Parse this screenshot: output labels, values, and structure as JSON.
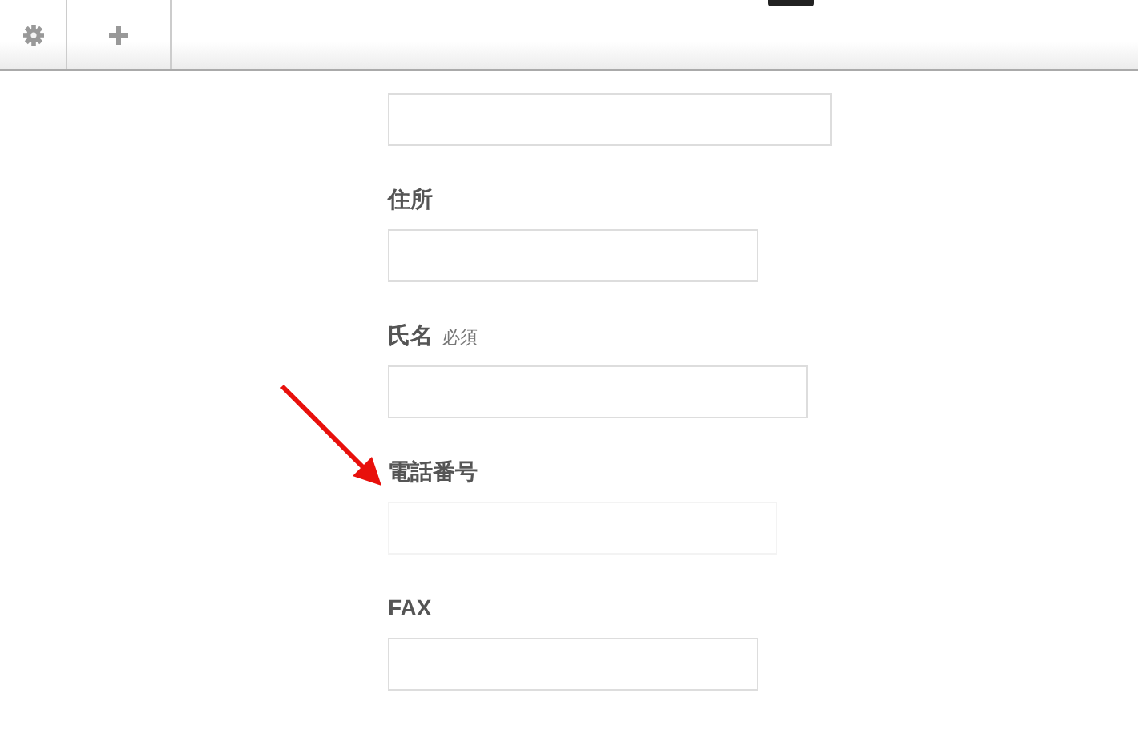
{
  "toolbar": {
    "buttons": [
      {
        "kind": "settings"
      },
      {
        "kind": "add"
      }
    ]
  },
  "top_field": {
    "kind": "normal"
  },
  "fields": [
    {
      "label": "住所",
      "kind": "normal"
    },
    {
      "label": "氏名",
      "required_text": "必須",
      "kind": "normal"
    },
    {
      "label": "電話番号",
      "kind": "faint"
    },
    {
      "label": "FAX",
      "kind": "normal"
    }
  ]
}
